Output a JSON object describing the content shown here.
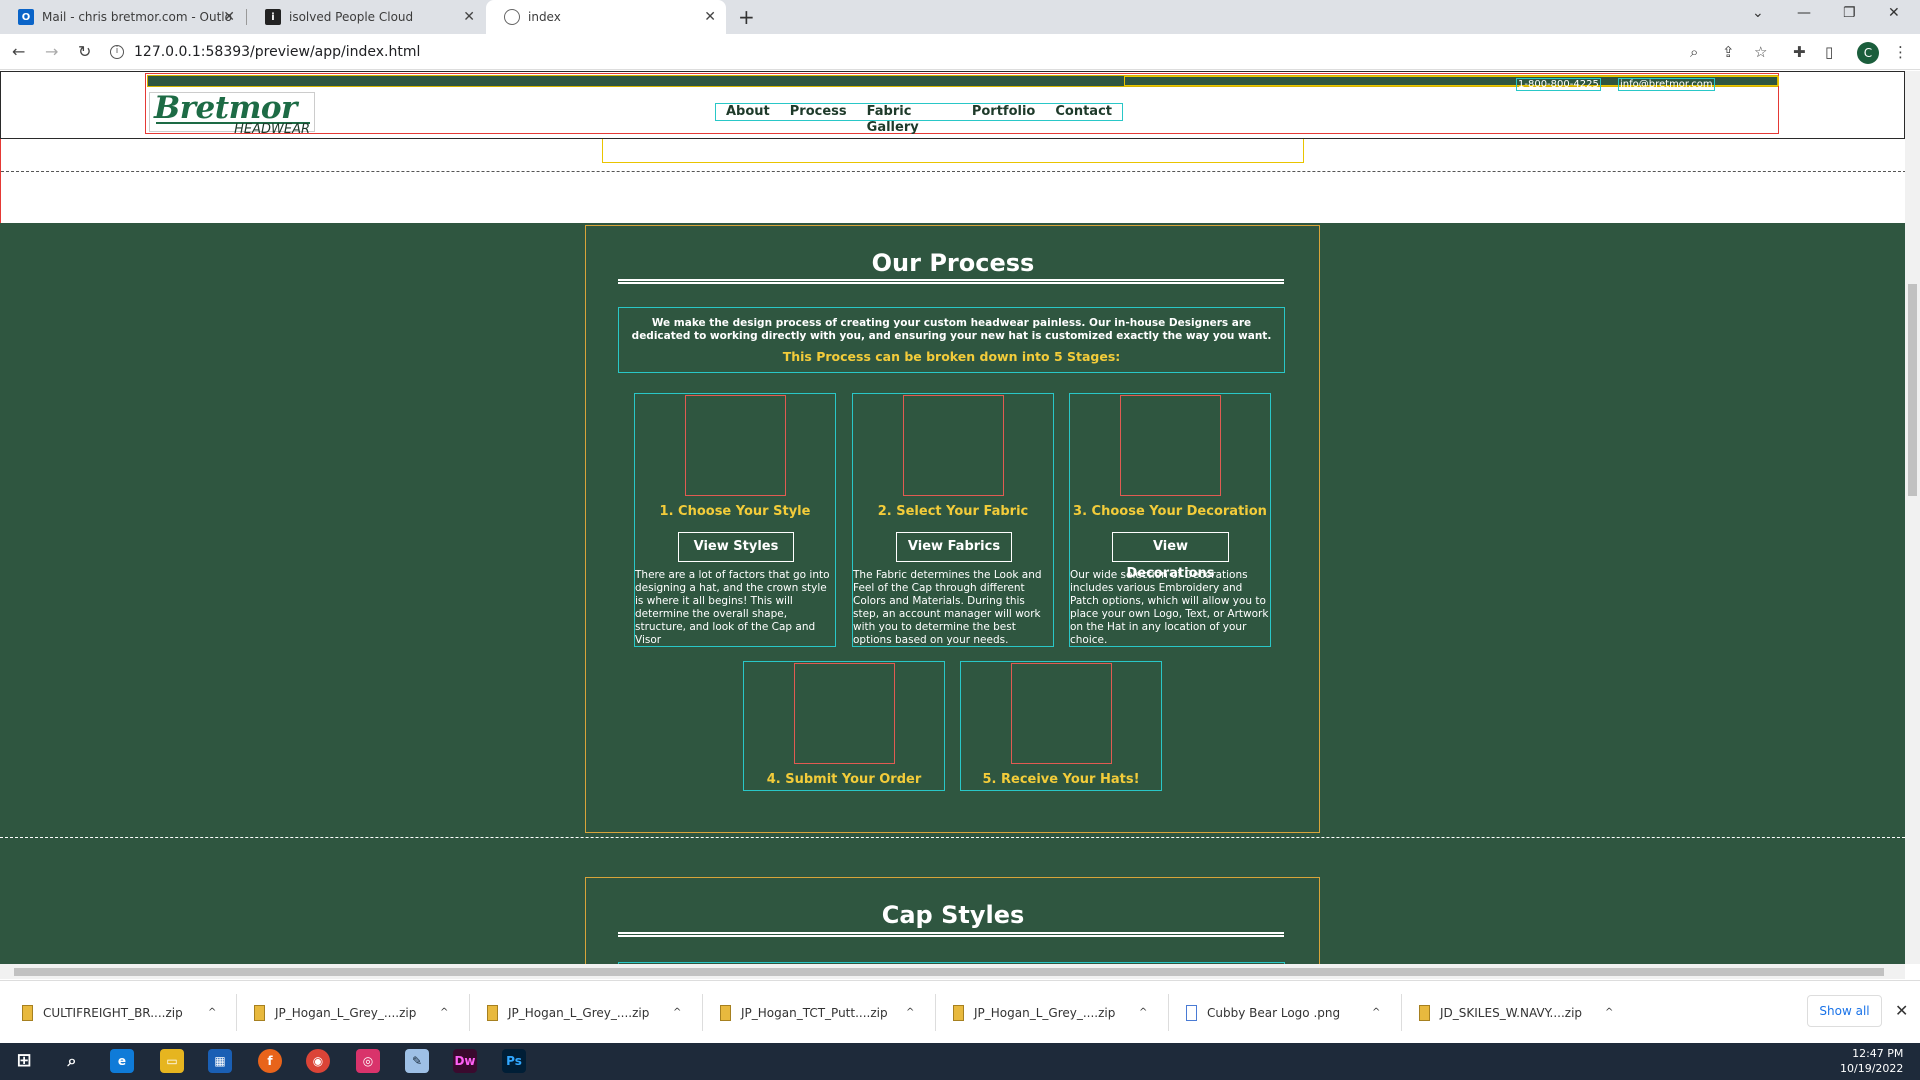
{
  "browser": {
    "tabs": [
      {
        "title": "Mail - chris bretmor.com - Outlo",
        "icon": "outlook-icon"
      },
      {
        "title": "isolved People Cloud",
        "icon": "isolved-icon"
      },
      {
        "title": "index",
        "icon": "globe-icon"
      }
    ],
    "url": "127.0.0.1:58393/preview/app/index.html",
    "profile_initial": "C"
  },
  "site": {
    "phone": "1-800-800-4225",
    "email": "info@bretmor.com",
    "logo_top": "Bretmor",
    "logo_bottom": "HEADWEAR",
    "nav": [
      "About",
      "Process",
      "Fabric Gallery",
      "Portfolio",
      "Contact"
    ]
  },
  "process": {
    "title": "Our Process",
    "intro": "We make the design process of creating your custom headwear painless. Our in-house Designers are dedicated to working directly with you, and ensuring your new hat is customized exactly the way you want.",
    "subtitle": "This Process can be broken down into 5 Stages:",
    "stages": [
      {
        "title": "1. Choose Your Style",
        "button": "View Styles",
        "desc": "There are a lot of factors that go into designing a hat, and the crown style is where it all begins! This will determine the overall shape, structure, and look of the Cap and Visor"
      },
      {
        "title": "2. Select Your Fabric",
        "button": "View Fabrics",
        "desc": "The Fabric determines the Look and Feel of the Cap through different Colors and Materials. During this step, an account manager will work with you to determine the best options based on your needs."
      },
      {
        "title": "3. Choose Your Decoration",
        "button": "View Decorations",
        "desc": "Our wide selection of Decorations includes various Embroidery and Patch options, which will allow you to place your own Logo, Text, or Artwork on the Hat in any location of your choice."
      },
      {
        "title": "4. Submit Your Order"
      },
      {
        "title": "5. Receive Your Hats!"
      }
    ]
  },
  "cap_styles": {
    "title": "Cap Styles"
  },
  "downloads": {
    "items": [
      "CULTIFREIGHT_BR....zip",
      "JP_Hogan_L_Grey_....zip",
      "JP_Hogan_L_Grey_....zip",
      "JP_Hogan_TCT_Putt....zip",
      "JP_Hogan_L_Grey_....zip",
      "Cubby Bear Logo .png",
      "JD_SKILES_W.NAVY....zip"
    ],
    "show_all": "Show all"
  },
  "taskbar": {
    "time": "12:47 PM",
    "date": "10/19/2022"
  },
  "colors": {
    "site_green": "#2f5640",
    "gold": "#f3cc3a",
    "cyan_outline": "#29c7c7",
    "red_outline": "#e15b52"
  }
}
